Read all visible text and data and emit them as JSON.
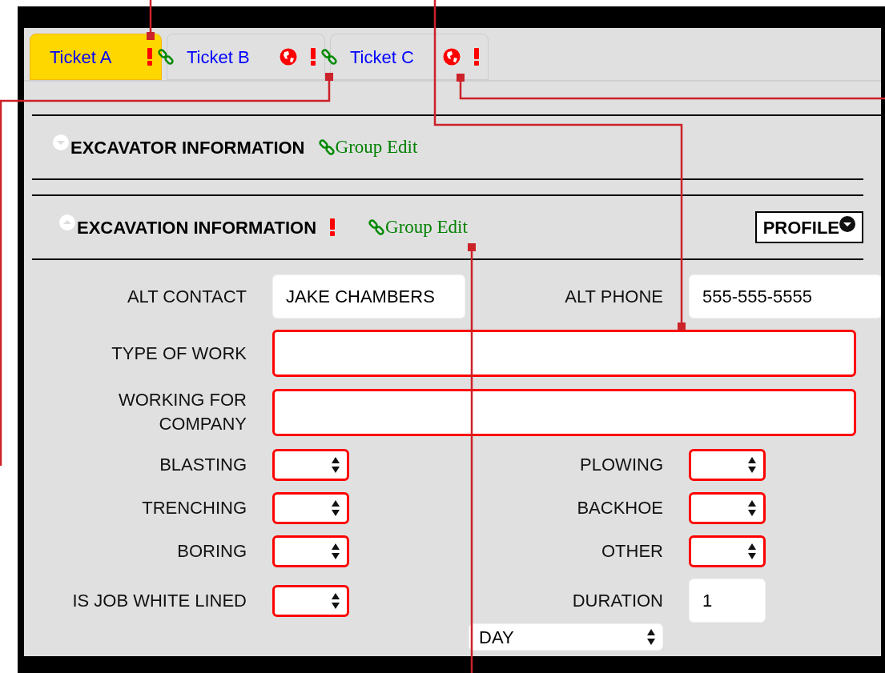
{
  "tabs": [
    {
      "label": "Ticket A",
      "selected": true,
      "icons": [
        {
          "kind": "alert"
        },
        {
          "kind": "link"
        }
      ]
    },
    {
      "label": "Ticket B",
      "selected": false,
      "icons": [
        {
          "kind": "globe"
        },
        {
          "kind": "alert"
        },
        {
          "kind": "link"
        }
      ]
    },
    {
      "label": "Ticket C",
      "selected": false,
      "icons": [
        {
          "kind": "globe"
        },
        {
          "kind": "alert"
        }
      ]
    }
  ],
  "sections": [
    {
      "title": "EXCAVATOR INFORMATION",
      "expanded": false,
      "alert": false,
      "link_label": "Group Edit"
    },
    {
      "title": "EXCAVATION INFORMATION",
      "expanded": true,
      "alert": true,
      "link_label": "Group Edit",
      "button": "PROFILE"
    }
  ],
  "rows": [
    {
      "kind": "pair",
      "fields": [
        {
          "label": "ALT CONTACT",
          "kind": "text",
          "value": "JAKE CHAMBERS",
          "required": false
        },
        {
          "label": "ALT PHONE",
          "kind": "text",
          "value": "555-555-5555",
          "required": false
        }
      ]
    },
    {
      "kind": "wide",
      "fields": [
        {
          "label": "TYPE OF WORK",
          "kind": "text",
          "required": true
        }
      ]
    },
    {
      "kind": "wide",
      "fields": [
        {
          "label": "WORKING FOR COMPANY",
          "kind": "text",
          "required": true
        }
      ]
    },
    {
      "kind": "pair",
      "fields": [
        {
          "label": "BLASTING",
          "kind": "select",
          "required": true
        },
        {
          "label": "PLOWING",
          "kind": "select",
          "required": true
        }
      ]
    },
    {
      "kind": "pair",
      "fields": [
        {
          "label": "TRENCHING",
          "kind": "select",
          "required": true
        },
        {
          "label": "BACKHOE",
          "kind": "select",
          "required": true
        }
      ]
    },
    {
      "kind": "pair",
      "fields": [
        {
          "label": "BORING",
          "kind": "select",
          "required": true
        },
        {
          "label": "OTHER",
          "kind": "select",
          "required": true
        }
      ]
    },
    {
      "kind": "pair",
      "fields": [
        {
          "label": "IS JOB WHITE LINED",
          "kind": "select",
          "required": true
        },
        {
          "label": "DURATION",
          "kind": "text",
          "value": "1",
          "required": false
        }
      ]
    }
  ],
  "unit_select": {
    "value": "DAY"
  }
}
